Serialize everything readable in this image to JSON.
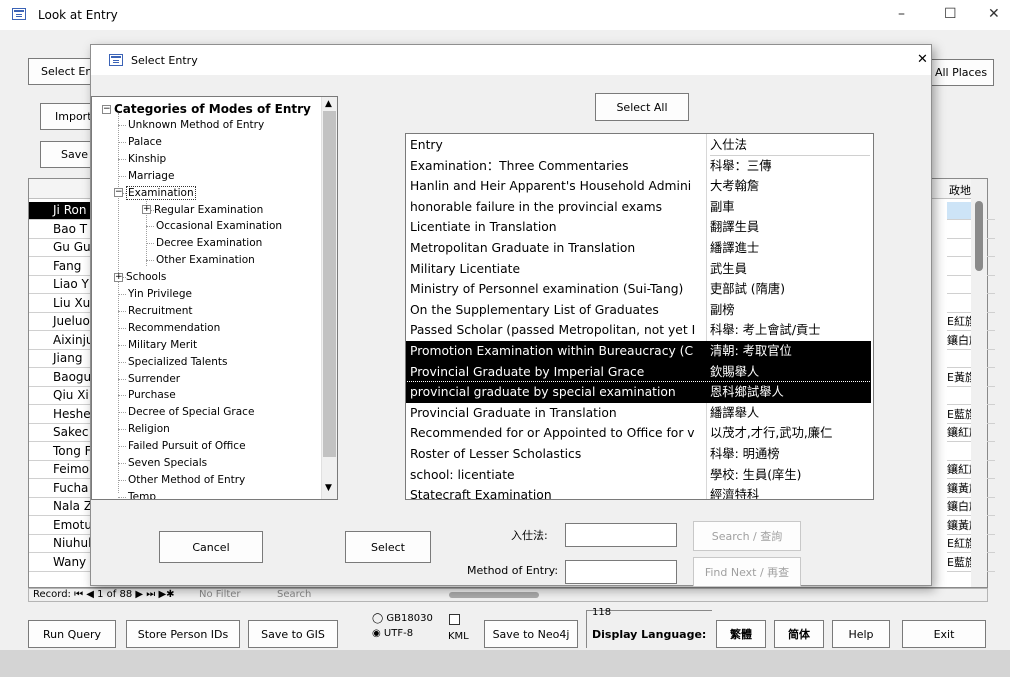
{
  "main_window": {
    "title": "Look at Entry",
    "controls": {
      "minimize": "–",
      "maximize": "☐",
      "close": "✕"
    },
    "select_entry_button": "Select En",
    "import_button": "Import",
    "save_button": "Save",
    "all_places_button": "All Places",
    "grid_right_header": "政地址",
    "grid_names": [
      "Ji Ron",
      "Bao T",
      "Gu Gu",
      "Fang ",
      "Liao Y",
      "Liu Xu",
      "Jueluo",
      "Aixinju",
      "Jiang",
      "Baogu",
      "Qiu Xi",
      "Heshe",
      "Sakec",
      "Tong F",
      "Feimo",
      "Fucha",
      "Nala Z",
      "Emotu",
      "Niuhul",
      "Wany"
    ],
    "grid_right_values": [
      "",
      "",
      "",
      "",
      "",
      "",
      "E紅旗",
      "鑲白旗",
      "",
      "E黃旗",
      "",
      "E藍旗",
      "鑲紅旗",
      "",
      "鑲紅旗",
      "鑲黃旗",
      "鑲白旗",
      "鑲黃旗",
      "E紅旗",
      "E藍旗"
    ],
    "record_nav": "Record: ⏮ ◀ 1 of 88 ▶ ⏭ ▶✱",
    "record_filter": "No Filter",
    "record_search": "Search"
  },
  "modal": {
    "title": "Select Entry",
    "close": "✕",
    "select_all_button": "Select All",
    "tree": {
      "root": "Categories of Modes of Entry",
      "items": [
        "Unknown Method of Entry",
        "Palace",
        "Kinship",
        "Marriage",
        "Examination",
        "Regular Examination",
        "Occasional Examination",
        "Decree Examination",
        "Other Examination",
        "Schools",
        "Yin Privilege",
        "Recruitment",
        "Recommendation",
        "Military Merit",
        "Specialized Talents",
        "Surrender",
        "Purchase",
        "Decree of Special Grace",
        "Religion",
        "Failed Pursuit of Office",
        "Seven Specials",
        "Other Method of Entry",
        "Temp"
      ]
    },
    "list": {
      "header_en": "Entry",
      "header_zh": "入仕法",
      "rows": [
        {
          "en": "Examination：Three Commentaries",
          "zh": "科舉：三傳"
        },
        {
          "en": "Hanlin and Heir Apparent's Household Admini",
          "zh": "大考翰詹"
        },
        {
          "en": "honorable failure in the provincial exams",
          "zh": "副車"
        },
        {
          "en": "Licentiate in Translation",
          "zh": "翻譯生員"
        },
        {
          "en": "Metropolitan Graduate in Translation",
          "zh": "繙譯進士"
        },
        {
          "en": "Military Licentiate",
          "zh": "武生員"
        },
        {
          "en": "Ministry of Personnel examination (Sui-Tang)",
          "zh": "吏部試 (隋唐)"
        },
        {
          "en": "On the Supplementary List of Graduates",
          "zh": "副榜"
        },
        {
          "en": "Passed Scholar (passed Metropolitan, not yet I",
          "zh": "科舉: 考上會試/貢士"
        },
        {
          "en": "Promotion Examination within Bureaucracy (C",
          "zh": "清朝: 考取官位"
        },
        {
          "en": "Provincial Graduate by Imperial Grace",
          "zh": "欽賜舉人"
        },
        {
          "en": "provincial graduate by special examination",
          "zh": "恩科鄉試舉人"
        },
        {
          "en": "Provincial Graduate in Translation",
          "zh": "繙譯舉人"
        },
        {
          "en": "Recommended for or Appointed to Office for v",
          "zh": "以茂才,才行,武功,廉仁"
        },
        {
          "en": "Roster of Lesser Scholastics",
          "zh": "科舉: 明通榜"
        },
        {
          "en": "school: licentiate",
          "zh": "學校: 生員(庠生)"
        },
        {
          "en": "Statecraft Examination",
          "zh": "經濟特科"
        }
      ]
    },
    "cancel_button": "Cancel",
    "select_button": "Select",
    "zh_label": "入仕法:",
    "method_label": "Method of Entry:",
    "search_button": "Search / 查詢",
    "find_next_button": "Find Next / 再查"
  },
  "toolbar": {
    "run_query": "Run Query",
    "store_person_ids": "Store Person IDs",
    "save_to_gis": "Save to GIS",
    "gb18030": "GB18030",
    "utf8": "UTF-8",
    "kml": "KML",
    "save_to_neo4j": "Save to Neo4j",
    "count": "118",
    "display_language_label": "Display Language:",
    "traditional": "繁體",
    "simplified": "简体",
    "help": "Help",
    "exit": "Exit"
  }
}
